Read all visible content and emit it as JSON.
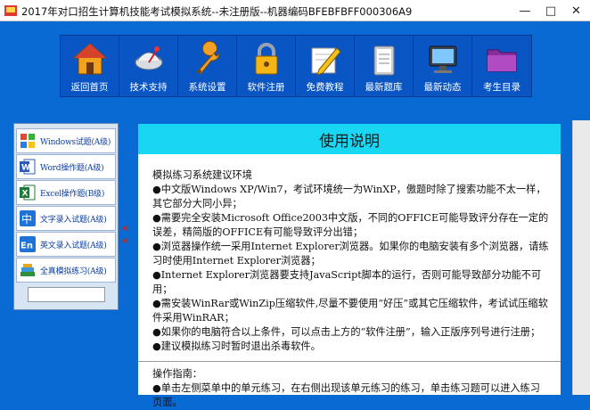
{
  "window": {
    "title": "2017年对口招生计算机技能考试模拟系统--未注册版--机器编码BFEBFBFF000306A9",
    "min_glyph": "—",
    "max_glyph": "□",
    "close_glyph": "✕"
  },
  "toolbar": {
    "items": [
      {
        "label": "返回首页",
        "icon": "home-icon"
      },
      {
        "label": "技术支持",
        "icon": "satellite-icon"
      },
      {
        "label": "系统设置",
        "icon": "wrench-icon"
      },
      {
        "label": "软件注册",
        "icon": "lock-icon"
      },
      {
        "label": "免费教程",
        "icon": "pencil-icon"
      },
      {
        "label": "最新题库",
        "icon": "clipboard-icon"
      },
      {
        "label": "最新动态",
        "icon": "monitor-icon"
      },
      {
        "label": "考生目录",
        "icon": "folder-icon"
      }
    ]
  },
  "sidebar": {
    "items": [
      {
        "label": "Windows试题(A级)",
        "icon": "windows-icon"
      },
      {
        "label": "Word操作题(A级)",
        "icon": "word-icon"
      },
      {
        "label": "Excel操作题(B级)",
        "icon": "excel-icon"
      },
      {
        "label": "文字录入试题(A级)",
        "icon": "chinese-input-icon"
      },
      {
        "label": "英文录入试题(A级)",
        "icon": "english-input-icon"
      },
      {
        "label": "全真模拟练习(A级)",
        "icon": "books-icon"
      }
    ],
    "collapse_glyph": "«\n«"
  },
  "content": {
    "header": "使用说明",
    "paragraphs": [
      "模拟练习系统建议环境",
      "●中文版Windows XP/Win7，考试环境统一为WinXP，傲题时除了搜索功能不太一样，其它部分大同小异；",
      "●需要完全安装Microsoft Office2003中文版，不同的OFFICE可能导致评分存在一定的误差，精简版的OFFICE有可能导致评分出错；",
      "●浏览器操作统一采用Internet Explorer浏览器。如果你的电脑安装有多个浏览器，请练习时使用Internet Explorer浏览器；",
      "●Internet Explorer浏览器要支持JavaScript脚本的运行，否则可能导致部分功能不可用；",
      "●需安装WinRar或WinZip压缩软件,尽量不要使用“好压”或其它压缩软件，考试试压缩软件采用WinRAR；",
      "●如果你的电脑符合以上条件，可以点击上方的“软件注册”，输入正版序列号进行注册；",
      "●建议模拟练习时暂时退出杀毒软件。"
    ],
    "guide_title": "操作指南：",
    "guide_text": "●单击左侧菜单中的单元练习，在右侧出现该单元练习的练习，单击练习题可以进入练习页面。"
  }
}
